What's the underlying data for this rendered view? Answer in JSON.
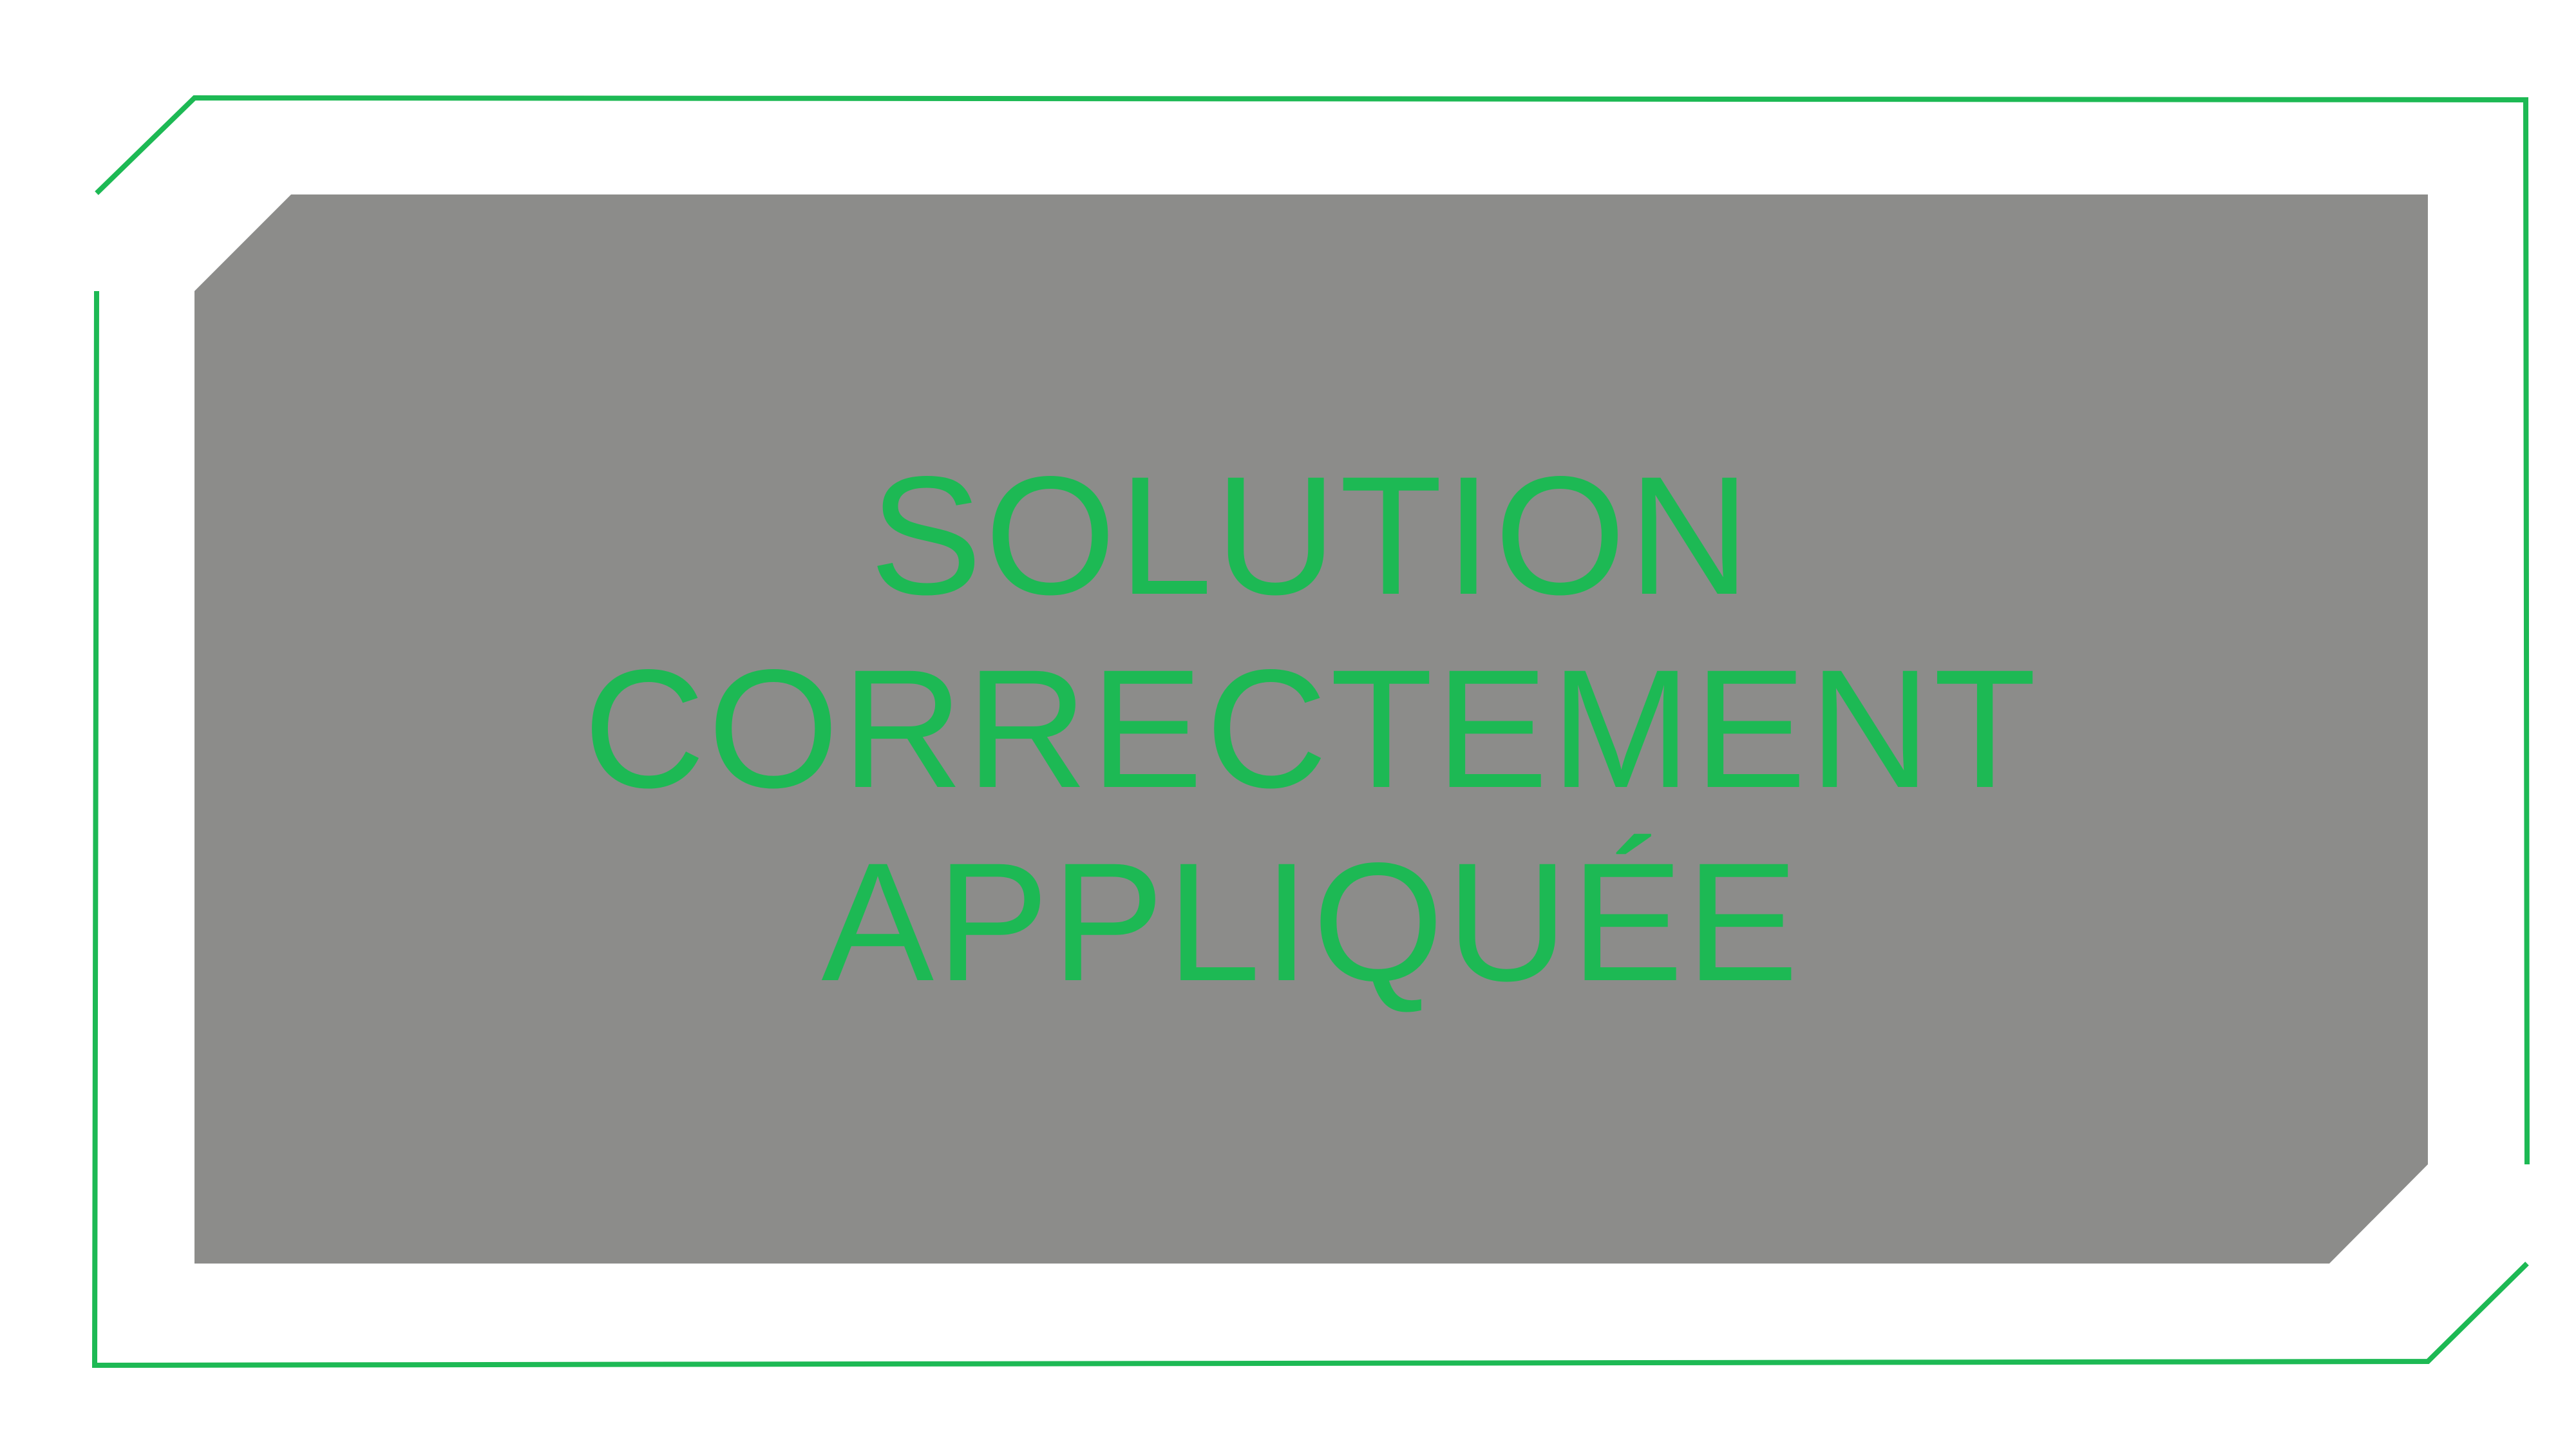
{
  "message": {
    "lines": [
      "SOLUTION",
      "CORRECTEMENT",
      "APPLIQUÉE"
    ]
  },
  "colors": {
    "accent": "#1db954",
    "panel": "#8c8c8a",
    "background": "#ffffff"
  }
}
